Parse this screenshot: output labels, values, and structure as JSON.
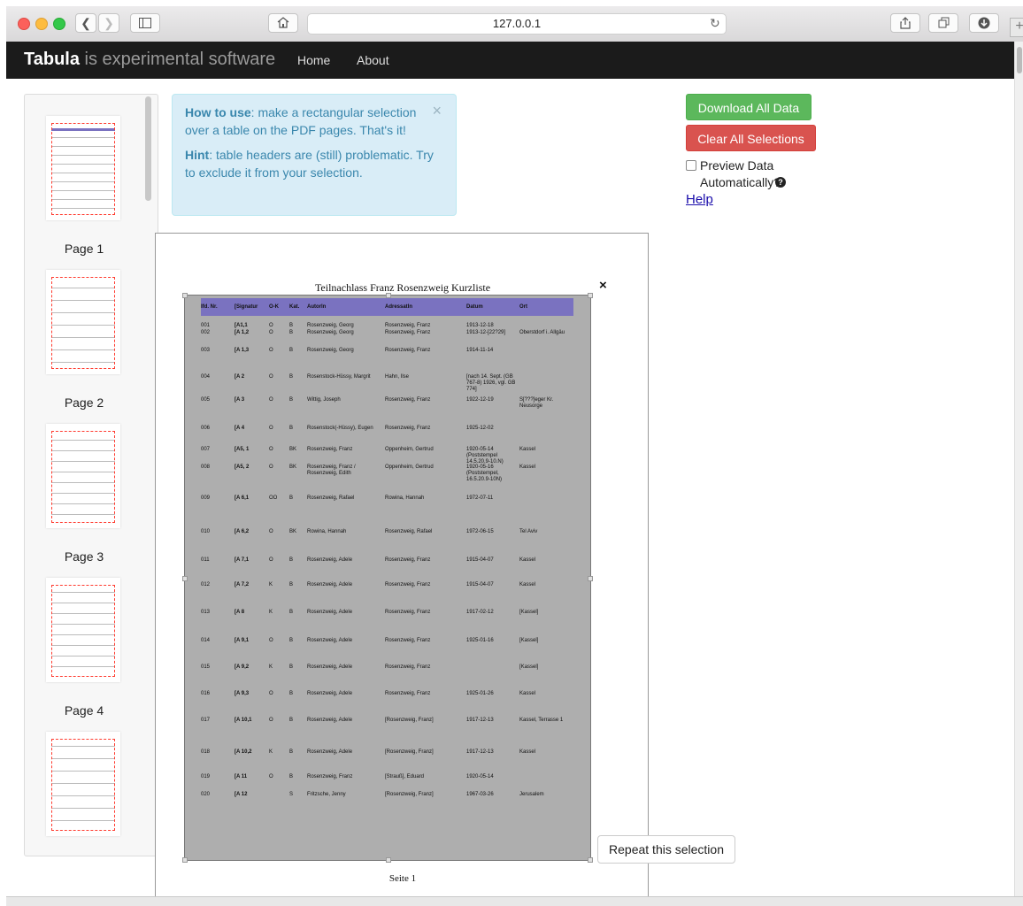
{
  "browser": {
    "url": "127.0.0.1",
    "icons": [
      "back-icon",
      "forward-icon",
      "sidebar-icon",
      "home-icon",
      "reload-icon",
      "share-icon",
      "tabs-icon",
      "download-icon",
      "new-tab-icon"
    ]
  },
  "navbar": {
    "brand_bold": "Tabula",
    "brand_rest": " is experimental software",
    "links": [
      "Home",
      "About"
    ]
  },
  "sidebar": {
    "pages": [
      "Page 1",
      "Page 2",
      "Page 3",
      "Page 4"
    ]
  },
  "alert": {
    "how_label": "How to use",
    "how_text": ": make a rectangular selection over a table on the PDF pages. That's it!",
    "hint_label": "Hint",
    "hint_text": ": table headers are (still) problematic. Try to exclude it from your selection.",
    "close": "×"
  },
  "actions": {
    "download": "Download All Data",
    "clear": "Clear All Selections",
    "preview_label": "Preview Data Automatically?",
    "help": "Help",
    "repeat": "Repeat this selection",
    "selection_close": "×"
  },
  "pdf": {
    "title": "Teilnachlass Franz Rosenzweig Kurzliste",
    "footer": "Seite 1",
    "headers": [
      "lfd. Nr.",
      "[Signatur",
      "O-K",
      "Kat.",
      "AutorIn",
      "AdressatIn",
      "Datum",
      "Ort"
    ],
    "rows": [
      [
        "001",
        "[A1,1",
        "O",
        "B",
        "Rosenzweig, Georg",
        "Rosenzweig, Franz",
        "1913-12-18",
        ""
      ],
      [
        "002",
        "[A 1,2",
        "O",
        "B",
        "Rosenzweig, Georg",
        "Rosenzweig, Franz",
        "1913-12-[22?29]",
        "Oberstdorf i. Allgäu"
      ],
      [
        "003",
        "[A 1,3",
        "O",
        "B",
        "Rosenzweig, Georg",
        "Rosenzweig, Franz",
        "1914-11-14",
        ""
      ],
      [
        "004",
        "[A 2",
        "O",
        "B",
        "Rosenstock-Hüssy, Margrit",
        "Hahn, Ilse",
        "[nach 14. Sept. (GB 767-8) 1926, vgl. GB 774]",
        ""
      ],
      [
        "005",
        "[A 3",
        "O",
        "B",
        "Wittig, Joseph",
        "Rosenzweig, Franz",
        "1922-12-19",
        "S[???]eger Kr. Neusorge"
      ],
      [
        "006",
        "[A 4",
        "O",
        "B",
        "Rosenstock(-Hüssy), Eugen",
        "Rosenzweig, Franz",
        "1925-12-02",
        ""
      ],
      [
        "007",
        "[A5, 1",
        "O",
        "BK",
        "Rosenzweig, Franz",
        "Oppenheim, Gertrud",
        "1920-05-14 (Poststempel 14.5.20.9-10.N)",
        "Kassel"
      ],
      [
        "008",
        "[A5, 2",
        "O",
        "BK",
        "Rosenzweig, Franz / Rosenzweig, Edith",
        "Oppenheim, Gertrud",
        "1920-05-16 (Poststempel, 16.5.20.9-10N)",
        "Kassel"
      ],
      [
        "009",
        "[A 6,1",
        "OO",
        "B",
        "Rosenzweig, Rafael",
        "Rowina, Hannah",
        "1972-07-11",
        ""
      ],
      [
        "010",
        "[A 6,2",
        "O",
        "BK",
        "Rowina, Hannah",
        "Rosenzweig, Rafael",
        "1972-06-15",
        "Tel Aviv"
      ],
      [
        "011",
        "[A 7,1",
        "O",
        "B",
        "Rosenzweig, Adele",
        "Rosenzweig, Franz",
        "1915-04-07",
        "Kassel"
      ],
      [
        "012",
        "[A 7,2",
        "K",
        "B",
        "Rosenzweig, Adele",
        "Rosenzweig, Franz",
        "1915-04-07",
        "Kassel"
      ],
      [
        "013",
        "[A 8",
        "K",
        "B",
        "Rosenzweig, Adele",
        "Rosenzweig, Franz",
        "1917-02-12",
        "[Kassel]"
      ],
      [
        "014",
        "[A 9,1",
        "O",
        "B",
        "Rosenzweig, Adele",
        "Rosenzweig, Franz",
        "1925-01-16",
        "[Kassel]"
      ],
      [
        "015",
        "[A 9,2",
        "K",
        "B",
        "Rosenzweig, Adele",
        "Rosenzweig, Franz",
        "",
        "[Kassel]"
      ],
      [
        "016",
        "[A 9,3",
        "O",
        "B",
        "Rosenzweig, Adele",
        "Rosenzweig, Franz",
        "1925-01-26",
        "Kassel"
      ],
      [
        "017",
        "[A 10,1",
        "O",
        "B",
        "Rosenzweig, Adele",
        "[Rosenzweig, Franz]",
        "1917-12-13",
        "Kassel, Terrasse 1"
      ],
      [
        "018",
        "[A 10,2",
        "K",
        "B",
        "Rosenzweig, Adele",
        "[Rosenzweig, Franz]",
        "1917-12-13",
        "Kassel"
      ],
      [
        "019",
        "[A 11",
        "O",
        "B",
        "Rosenzweig, Franz",
        "[Strauß], Eduard",
        "1920-05-14",
        ""
      ],
      [
        "020",
        "[A 12",
        "",
        "S",
        "Fritzsche, Jenny",
        "[Rosenzweig, Franz]",
        "1967-03-26",
        "Jerusalem"
      ]
    ]
  },
  "colors": {
    "navbar": "#1b1b1b",
    "download": "#5cb85c",
    "clear": "#d9534f",
    "alert_bg": "#d9edf7",
    "alert_text": "#3a87ad",
    "table_header": "#7a72c0",
    "selection_dash": "#ff3b2f"
  }
}
